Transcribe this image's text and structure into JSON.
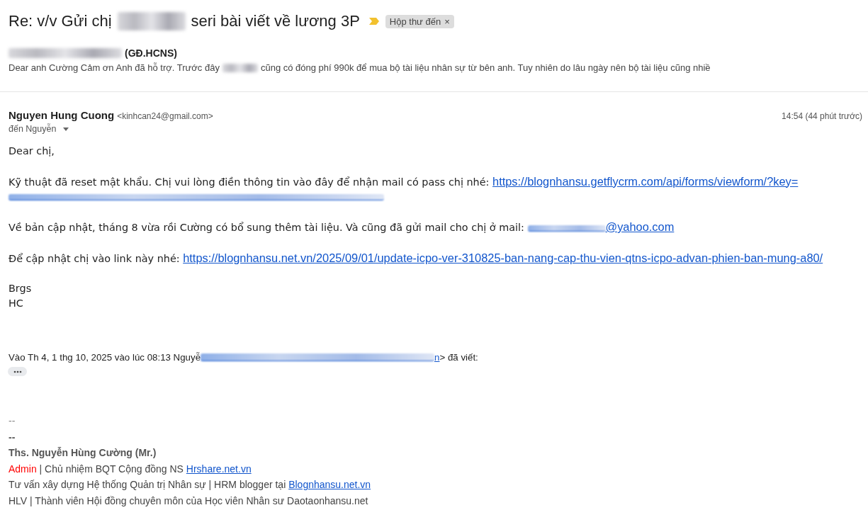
{
  "subject": {
    "parts": [
      {
        "kind": "text",
        "text": "Re: v/v Gửi chị"
      },
      {
        "kind": "redacted"
      },
      {
        "kind": "text",
        "text": "seri bài viết về lương 3P"
      }
    ],
    "important": true,
    "label": {
      "text": "Hộp thư đến",
      "remove": "×"
    }
  },
  "summary": {
    "sender": [
      {
        "kind": "redacted"
      },
      {
        "kind": "text",
        "text": "(GĐ.HCNS)"
      }
    ],
    "snippet": [
      {
        "kind": "text",
        "text": "Dear anh Cường Cảm ơn Anh đã hỗ trợ. Trước đây"
      },
      {
        "kind": "redacted"
      },
      {
        "kind": "text",
        "text": "cũng có đóng phí 990k để mua bộ tài liệu nhân sự từ bên anh. Tuy nhiên do lâu ngày nên bộ tài liệu cũng nhiề"
      }
    ]
  },
  "message": {
    "sender_name": "Nguyen Hung Cuong",
    "sender_email": "<kinhcan24@gmail.com>",
    "time": "14:54 (44 phút trước)",
    "recipient": "đến Nguyễn",
    "body": [
      [
        [
          {
            "kind": "text",
            "text": "Dear chị,"
          }
        ]
      ],
      [
        [
          {
            "kind": "text",
            "text": "Kỹ thuật đã reset mật khẩu. Chị vui lòng điền thông tin vào đây để nhận mail có pass chị nhé: "
          },
          {
            "kind": "link",
            "text": "https://blognhansu.getflycrm.com/api/forms/viewform/?key="
          }
        ],
        [
          {
            "kind": "redacted_link"
          }
        ]
      ],
      [
        [
          {
            "kind": "text",
            "text": "Về bản cập nhật, tháng 8 vừa rồi Cường có bổ sung thêm tài liệu. Và cũng đã gửi mail cho chị ở mail: "
          },
          {
            "kind": "redacted_link"
          },
          {
            "kind": "link",
            "text": "@yahoo.com"
          }
        ]
      ],
      [
        [
          {
            "kind": "text",
            "text": "Để cập nhật chị vào link này nhé: "
          },
          {
            "kind": "link",
            "text": "https://blognhansu.net.vn/2025/09/01/update-icpo-ver-310825-ban-nang-cap-thu-vien-qtns-icpo-advan-phien-ban-mung-a80/"
          }
        ]
      ],
      [
        [
          {
            "kind": "text",
            "text": "Brgs"
          }
        ],
        [
          {
            "kind": "text",
            "text": "HC"
          }
        ]
      ]
    ],
    "quote_header": [
      {
        "kind": "text",
        "text": "Vào Th 4, 1 thg 10, 2025 vào lúc 08:13 Nguyễ"
      },
      {
        "kind": "redacted_link"
      },
      {
        "kind": "link",
        "text": "n"
      },
      {
        "kind": "text",
        "text": "> đã viết:"
      }
    ],
    "trimmed_content": true
  },
  "signature": [
    [
      {
        "kind": "muted",
        "text": "--"
      }
    ],
    [
      {
        "kind": "bold",
        "text": "--"
      }
    ],
    [
      {
        "kind": "bold",
        "text": "Ths. Nguyễn Hùng Cường (Mr.)"
      }
    ],
    [
      {
        "kind": "alert",
        "text": "Admin"
      },
      {
        "kind": "text",
        "text": " | Chủ nhiệm BQT Cộng đồng NS "
      },
      {
        "kind": "link",
        "text": "Hrshare.net.vn"
      }
    ],
    [
      {
        "kind": "text",
        "text": "Tư vấn xây dựng Hệ thống Quản trị Nhân sự | HRM blogger tại "
      },
      {
        "kind": "link",
        "text": "Blognhansu.net.vn"
      }
    ],
    [
      {
        "kind": "text",
        "text": "HLV | Thành viên Hội đồng chuyên môn của Học viên Nhân sư Daotaonhansu.net"
      }
    ]
  ]
}
